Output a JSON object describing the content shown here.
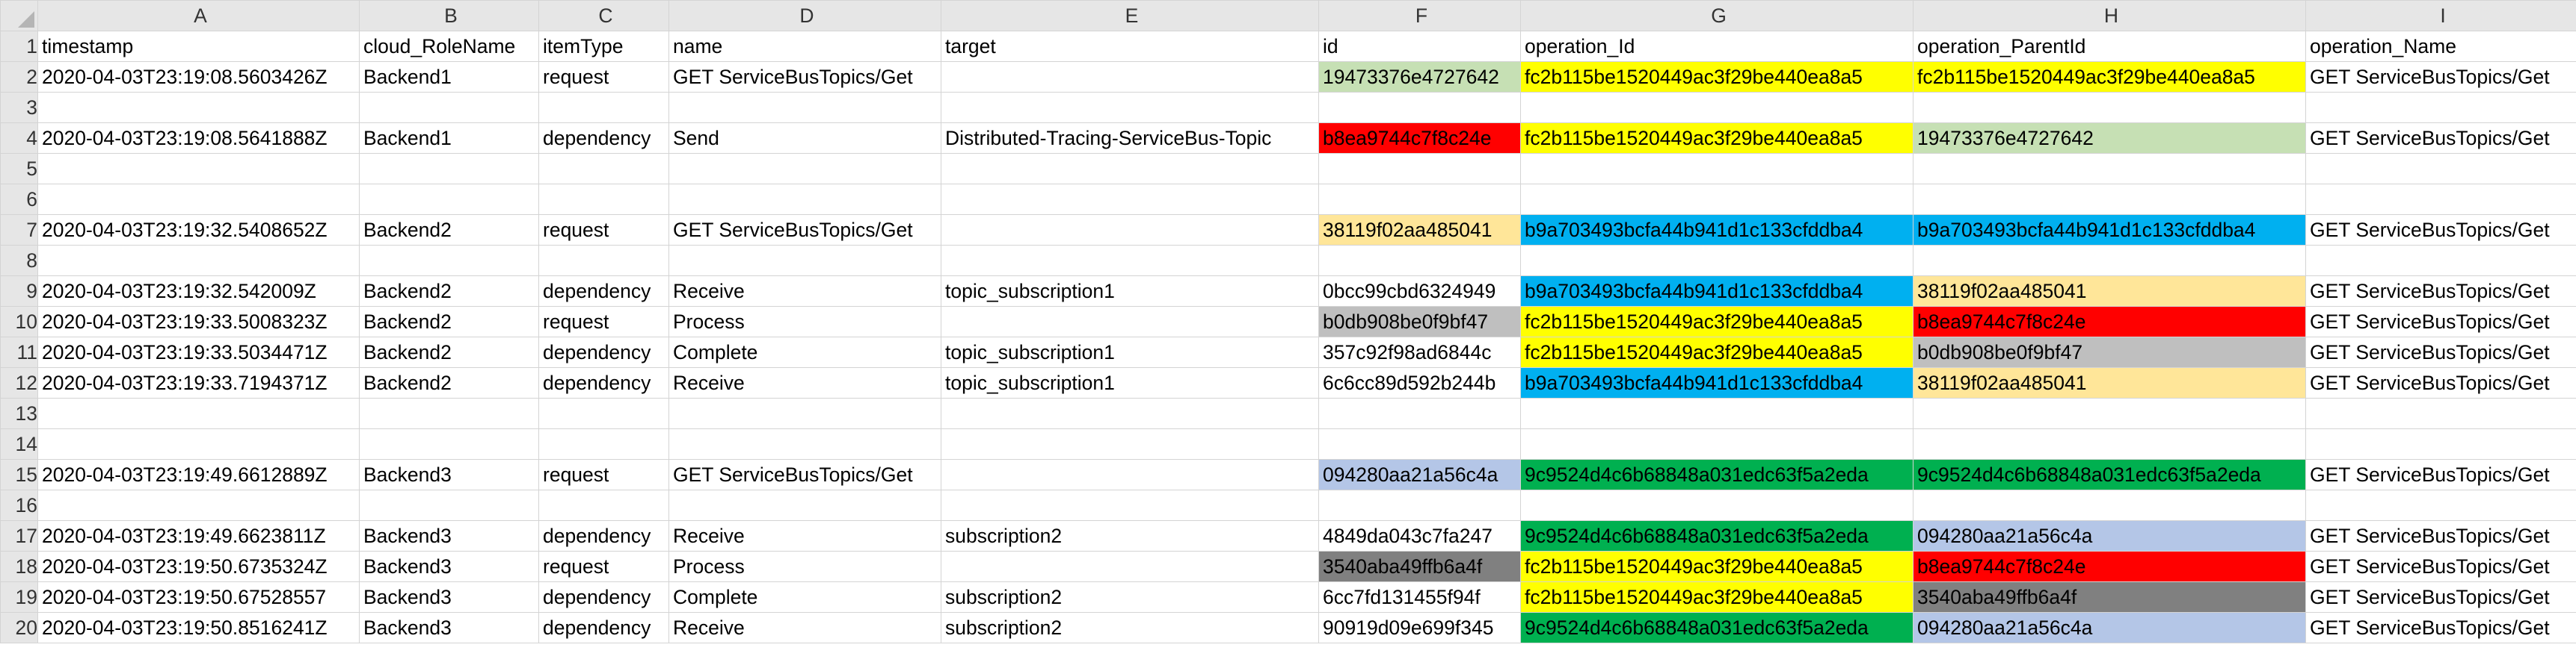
{
  "columns": [
    "A",
    "B",
    "C",
    "D",
    "E",
    "F",
    "G",
    "H",
    "I"
  ],
  "row_numbers": [
    "1",
    "2",
    "3",
    "4",
    "5",
    "6",
    "7",
    "8",
    "9",
    "10",
    "11",
    "12",
    "13",
    "14",
    "15",
    "16",
    "17",
    "18",
    "19",
    "20"
  ],
  "rows": [
    [
      "timestamp",
      "cloud_RoleName",
      "itemType",
      "name",
      "target",
      "id",
      "operation_Id",
      "operation_ParentId",
      "operation_Name"
    ],
    [
      "2020-04-03T23:19:08.5603426Z",
      "Backend1",
      "request",
      "GET ServiceBusTopics/Get",
      "",
      "19473376e4727642",
      "fc2b115be1520449ac3f29be440ea8a5",
      "fc2b115be1520449ac3f29be440ea8a5",
      "GET ServiceBusTopics/Get"
    ],
    [
      "",
      "",
      "",
      "",
      "",
      "",
      "",
      "",
      ""
    ],
    [
      "2020-04-03T23:19:08.5641888Z",
      "Backend1",
      "dependency",
      "Send",
      "Distributed-Tracing-ServiceBus-Topic",
      "b8ea9744c7f8c24e",
      "fc2b115be1520449ac3f29be440ea8a5",
      "19473376e4727642",
      "GET ServiceBusTopics/Get"
    ],
    [
      "",
      "",
      "",
      "",
      "",
      "",
      "",
      "",
      ""
    ],
    [
      "",
      "",
      "",
      "",
      "",
      "",
      "",
      "",
      ""
    ],
    [
      "2020-04-03T23:19:32.5408652Z",
      "Backend2",
      "request",
      "GET ServiceBusTopics/Get",
      "",
      "38119f02aa485041",
      "b9a703493bcfa44b941d1c133cfddba4",
      "b9a703493bcfa44b941d1c133cfddba4",
      "GET ServiceBusTopics/Get"
    ],
    [
      "",
      "",
      "",
      "",
      "",
      "",
      "",
      "",
      ""
    ],
    [
      "2020-04-03T23:19:32.542009Z",
      "Backend2",
      "dependency",
      "Receive",
      "topic_subscription1",
      "0bcc99cbd6324949",
      "b9a703493bcfa44b941d1c133cfddba4",
      "38119f02aa485041",
      "GET ServiceBusTopics/Get"
    ],
    [
      "2020-04-03T23:19:33.5008323Z",
      "Backend2",
      "request",
      "Process",
      "",
      "b0db908be0f9bf47",
      "fc2b115be1520449ac3f29be440ea8a5",
      "b8ea9744c7f8c24e",
      "GET ServiceBusTopics/Get"
    ],
    [
      "2020-04-03T23:19:33.5034471Z",
      "Backend2",
      "dependency",
      "Complete",
      "topic_subscription1",
      "357c92f98ad6844c",
      "fc2b115be1520449ac3f29be440ea8a5",
      "b0db908be0f9bf47",
      "GET ServiceBusTopics/Get"
    ],
    [
      "2020-04-03T23:19:33.7194371Z",
      "Backend2",
      "dependency",
      "Receive",
      "topic_subscription1",
      "6c6cc89d592b244b",
      "b9a703493bcfa44b941d1c133cfddba4",
      "38119f02aa485041",
      "GET ServiceBusTopics/Get"
    ],
    [
      "",
      "",
      "",
      "",
      "",
      "",
      "",
      "",
      ""
    ],
    [
      "",
      "",
      "",
      "",
      "",
      "",
      "",
      "",
      ""
    ],
    [
      "2020-04-03T23:19:49.6612889Z",
      "Backend3",
      "request",
      "GET ServiceBusTopics/Get",
      "",
      "094280aa21a56c4a",
      "9c9524d4c6b68848a031edc63f5a2eda",
      "9c9524d4c6b68848a031edc63f5a2eda",
      "GET ServiceBusTopics/Get"
    ],
    [
      "",
      "",
      "",
      "",
      "",
      "",
      "",
      "",
      ""
    ],
    [
      "2020-04-03T23:19:49.6623811Z",
      "Backend3",
      "dependency",
      "Receive",
      "subscription2",
      "4849da043c7fa247",
      "9c9524d4c6b68848a031edc63f5a2eda",
      "094280aa21a56c4a",
      "GET ServiceBusTopics/Get"
    ],
    [
      "2020-04-03T23:19:50.6735324Z",
      "Backend3",
      "request",
      "Process",
      "",
      "3540aba49ffb6a4f",
      "fc2b115be1520449ac3f29be440ea8a5",
      "b8ea9744c7f8c24e",
      "GET ServiceBusTopics/Get"
    ],
    [
      "2020-04-03T23:19:50.67528557",
      "Backend3",
      "dependency",
      "Complete",
      "subscription2",
      "6cc7fd131455f94f",
      "fc2b115be1520449ac3f29be440ea8a5",
      "3540aba49ffb6a4f",
      "GET ServiceBusTopics/Get"
    ],
    [
      "2020-04-03T23:19:50.8516241Z",
      "Backend3",
      "dependency",
      "Receive",
      "subscription2",
      "90919d09e699f345",
      "9c9524d4c6b68848a031edc63f5a2eda",
      "094280aa21a56c4a",
      "GET ServiceBusTopics/Get"
    ]
  ],
  "cell_fills": {
    "1": {
      "5": "#c6e0b4",
      "6": "#ffff00",
      "7": "#ffff00"
    },
    "3": {
      "5": "#ff0000",
      "6": "#ffff00",
      "7": "#c6e0b4"
    },
    "6": {
      "5": "#ffe699",
      "6": "#00b0f0",
      "7": "#00b0f0"
    },
    "8": {
      "6": "#00b0f0",
      "7": "#ffe699"
    },
    "9": {
      "5": "#bfbfbf",
      "6": "#ffff00",
      "7": "#ff0000"
    },
    "10": {
      "6": "#ffff00",
      "7": "#bfbfbf"
    },
    "11": {
      "6": "#00b0f0",
      "7": "#ffe699"
    },
    "14": {
      "5": "#b4c6e7",
      "6": "#00b050",
      "7": "#00b050"
    },
    "16": {
      "6": "#00b050",
      "7": "#b4c6e7"
    },
    "17": {
      "5": "#808080",
      "6": "#ffff00",
      "7": "#ff0000"
    },
    "18": {
      "6": "#ffff00",
      "7": "#808080"
    },
    "19": {
      "6": "#00b050",
      "7": "#b4c6e7"
    }
  }
}
